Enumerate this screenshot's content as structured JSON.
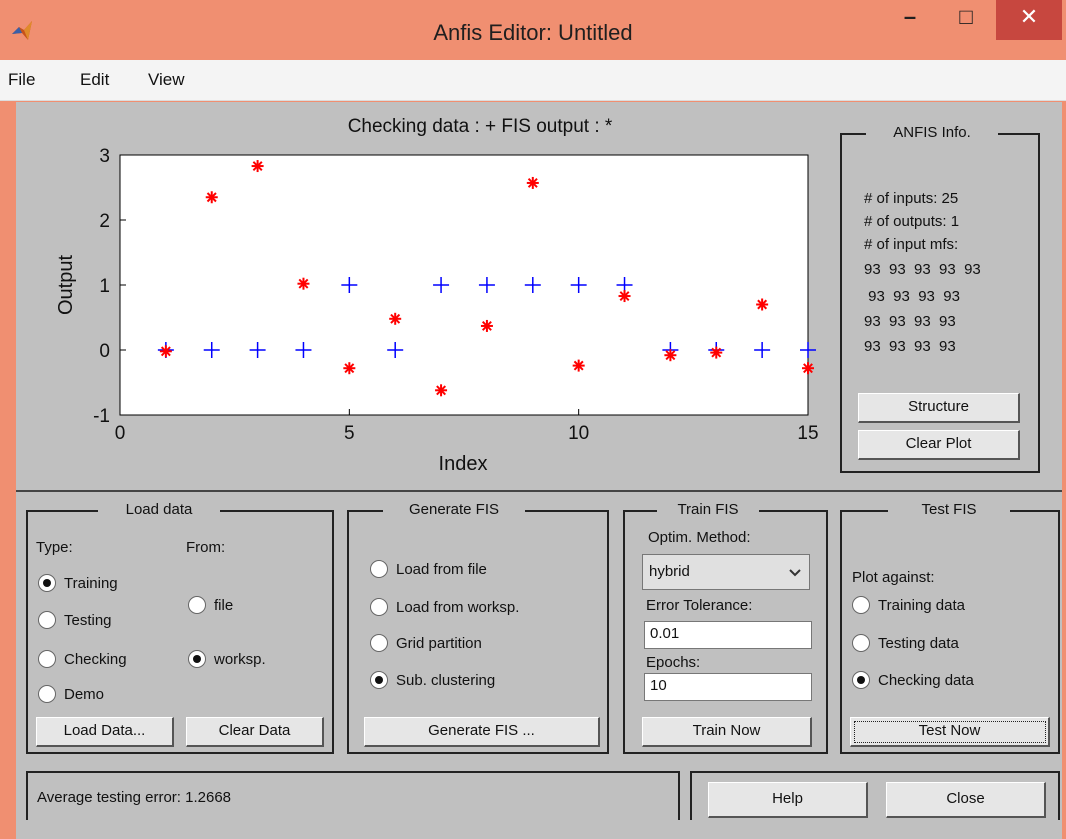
{
  "window": {
    "title": "Anfis Editor: Untitled",
    "minimize": "–",
    "maximize": "□",
    "close": "✕"
  },
  "menu": [
    {
      "label": "File"
    },
    {
      "label": "Edit"
    },
    {
      "label": "View"
    }
  ],
  "plot": {
    "title": "Checking data : +   FIS output : *"
  },
  "chart_data": {
    "type": "scatter",
    "title": "Checking data : +   FIS output : *",
    "xlabel": "Index",
    "ylabel": "Output",
    "xlim": [
      0,
      15
    ],
    "ylim": [
      -1,
      3
    ],
    "xticks": [
      0,
      5,
      10,
      15
    ],
    "yticks": [
      -1,
      0,
      1,
      2,
      3
    ],
    "series": [
      {
        "name": "Checking data",
        "marker": "+",
        "color": "#0000ff",
        "points": [
          [
            1,
            0
          ],
          [
            2,
            0
          ],
          [
            3,
            0
          ],
          [
            4,
            0
          ],
          [
            5,
            1
          ],
          [
            6,
            0
          ],
          [
            7,
            1
          ],
          [
            8,
            1
          ],
          [
            9,
            1
          ],
          [
            10,
            1
          ],
          [
            11,
            1
          ],
          [
            12,
            0
          ],
          [
            13,
            0
          ],
          [
            14,
            0
          ],
          [
            15,
            0
          ]
        ]
      },
      {
        "name": "FIS output",
        "marker": "*",
        "color": "#ff0000",
        "points": [
          [
            1,
            -0.02
          ],
          [
            2,
            2.35
          ],
          [
            3,
            2.83
          ],
          [
            4,
            1.02
          ],
          [
            5,
            -0.28
          ],
          [
            6,
            0.48
          ],
          [
            7,
            -0.62
          ],
          [
            8,
            0.37
          ],
          [
            9,
            2.57
          ],
          [
            10,
            -0.24
          ],
          [
            11,
            0.83
          ],
          [
            12,
            -0.08
          ],
          [
            13,
            -0.04
          ],
          [
            14,
            0.7
          ],
          [
            15,
            -0.28
          ]
        ]
      }
    ]
  },
  "anfis_info": {
    "title": "ANFIS Info.",
    "inputs": "# of inputs: 25",
    "outputs": "# of outputs: 1",
    "input_mfs": "# of input mfs:",
    "mf_line1": "93  93  93  93  93",
    "mf_line2": " 93  93  93  93",
    "mf_line3": "93  93  93  93",
    "mf_line4": "93  93  93  93",
    "structure_button": "Structure",
    "clear_plot_button": "Clear Plot"
  },
  "load_data": {
    "title": "Load data",
    "type_label": "Type:",
    "from_label": "From:",
    "type_options": [
      {
        "label": "Training",
        "selected": true
      },
      {
        "label": "Testing",
        "selected": false
      },
      {
        "label": "Checking",
        "selected": false
      },
      {
        "label": "Demo",
        "selected": false
      }
    ],
    "from_options": [
      {
        "label": "file",
        "selected": false
      },
      {
        "label": "worksp.",
        "selected": true
      }
    ],
    "load_button": "Load Data...",
    "clear_button": "Clear Data"
  },
  "generate_fis": {
    "title": "Generate FIS",
    "options": [
      {
        "label": "Load from file",
        "selected": false
      },
      {
        "label": "Load from worksp.",
        "selected": false
      },
      {
        "label": "Grid partition",
        "selected": false
      },
      {
        "label": "Sub. clustering",
        "selected": true
      }
    ],
    "button": "Generate FIS ..."
  },
  "train_fis": {
    "title": "Train FIS",
    "method_label": "Optim. Method:",
    "method_value": "hybrid",
    "tolerance_label": "Error Tolerance:",
    "tolerance_value": "0.01",
    "epochs_label": "Epochs:",
    "epochs_value": "10",
    "button": "Train Now"
  },
  "test_fis": {
    "title": "Test FIS",
    "plot_against_label": "Plot against:",
    "options": [
      {
        "label": "Training data",
        "selected": false
      },
      {
        "label": "Testing data",
        "selected": false
      },
      {
        "label": "Checking data",
        "selected": true
      }
    ],
    "button": "Test Now"
  },
  "status": {
    "text": "Average testing error: 1.2668"
  },
  "footer": {
    "help_button": "Help",
    "close_button": "Close"
  }
}
